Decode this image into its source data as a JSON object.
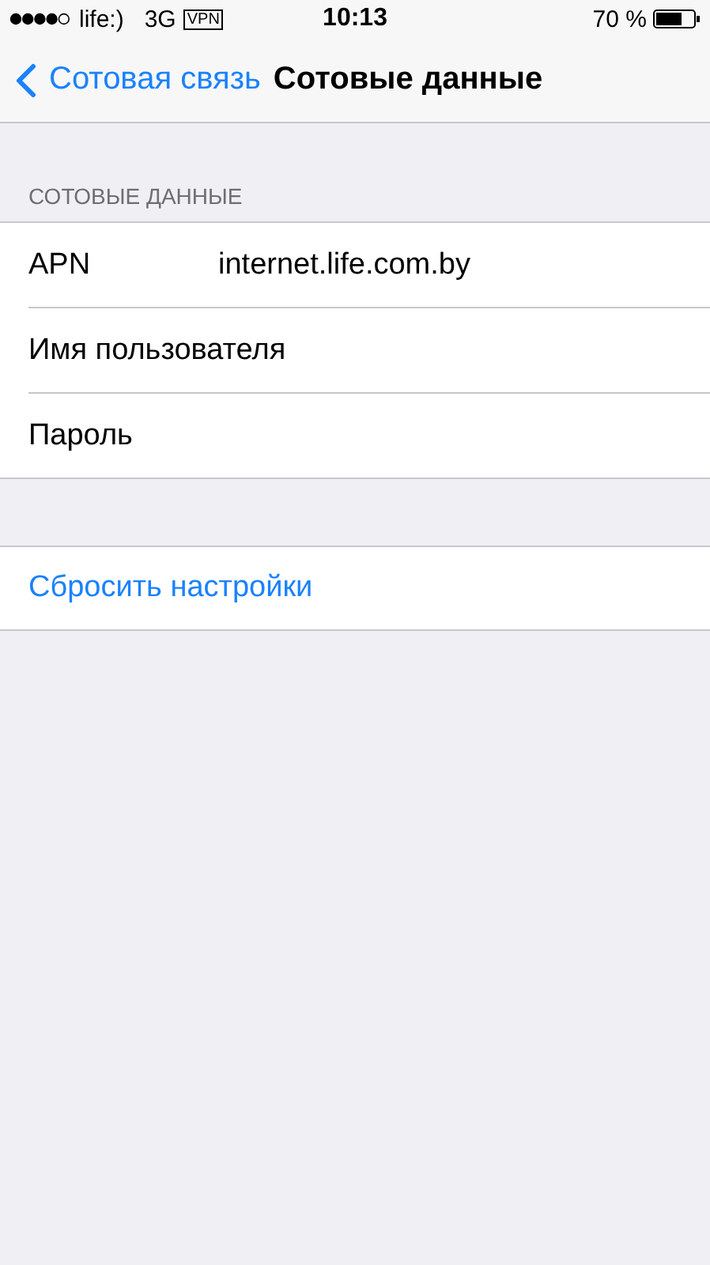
{
  "status_bar": {
    "carrier": "life:)",
    "network": "3G",
    "vpn": "VPN",
    "time": "10:13",
    "battery": "70 %"
  },
  "nav": {
    "back": "Сотовая связь",
    "title": "Сотовые данные"
  },
  "section": {
    "header": "СОТОВЫЕ ДАННЫЕ",
    "rows": [
      {
        "label": "APN",
        "value": "internet.life.com.by"
      },
      {
        "label": "Имя пользователя"
      },
      {
        "label": "Пароль"
      }
    ]
  },
  "reset": {
    "label": "Сбросить настройки"
  }
}
